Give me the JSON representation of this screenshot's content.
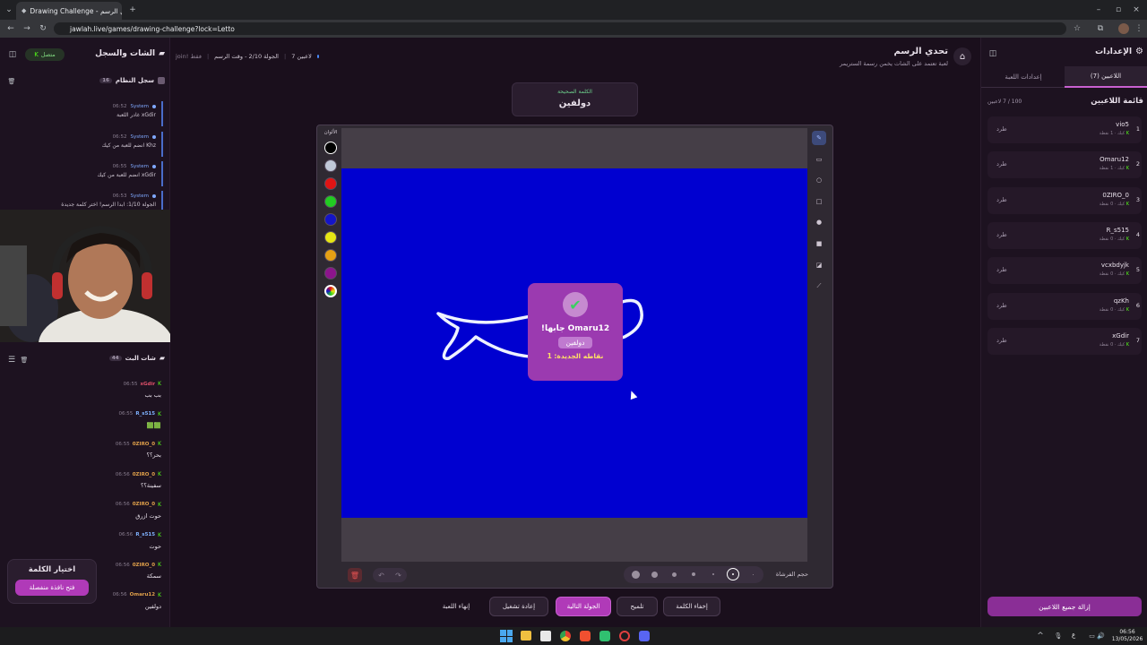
{
  "browser": {
    "tab_title": "Drawing Challenge - تحدي الرسم",
    "url": "jawlah.live/games/drawing-challenge?lock=Letto"
  },
  "left": {
    "title": "الشات والسجل",
    "status": "متصل",
    "system_log_title": "سجل النظام",
    "system_log_count": "16",
    "system_logs": [
      {
        "time": "06:52",
        "sender": "System",
        "text": "xGdir غادر اللعبة"
      },
      {
        "time": "06:52",
        "sender": "System",
        "text": "Khz انضم للعبة من كيك"
      },
      {
        "time": "06:55",
        "sender": "System",
        "text": "xGdir انضم للعبة من كيك"
      },
      {
        "time": "06:53",
        "sender": "System",
        "text": "الجولة 1/10: ابدأ الرسم! اختر كلمة جديدة"
      }
    ],
    "chat_title": "شات البث",
    "chat_count": "44",
    "chat": [
      {
        "time": "06:55",
        "user": "xGdir",
        "text": "بب بب",
        "color": "#e0506a"
      },
      {
        "time": "06:55",
        "user": "R_s515",
        "text": "🟩🟩",
        "color": "#7fb2ff"
      },
      {
        "time": "06:55",
        "user": "0ZIRO_0",
        "text": "بحر؟؟",
        "color": "#e0a04a"
      },
      {
        "time": "06:56",
        "user": "0ZIRO_0",
        "text": "سفينة؟؟",
        "color": "#e0a04a"
      },
      {
        "time": "06:56",
        "user": "0ZIRO_0",
        "text": "حوت ازرق",
        "color": "#e0a04a"
      },
      {
        "time": "06:56",
        "user": "R_s515",
        "text": "حوت",
        "color": "#7fb2ff"
      },
      {
        "time": "06:56",
        "user": "0ZIRO_0",
        "text": "سمكة",
        "color": "#e0a04a"
      },
      {
        "time": "06:56",
        "user": "Omaru12",
        "text": "دولفين",
        "color": "#e0a04a"
      }
    ],
    "word_pick_title": "اختيار الكلمة",
    "word_pick_button": "فتح نافذة منفصلة"
  },
  "header": {
    "title": "تحدي الرسم",
    "subtitle": "لعبة تعتمد على الشات يخمن رسمة الستريمر",
    "players_count": "7 لاعبين",
    "round_info": "الجولة 2/10 - وقت الرسم",
    "mode": "join! فقط"
  },
  "word_box": {
    "label": "الكلمة الصحيحة",
    "word": "دولفين"
  },
  "canvas": {
    "colors_label": "الألوان",
    "colors": [
      "#000000",
      "#c0c8d8",
      "#e01414",
      "#22cc22",
      "#1414c8",
      "#e6e614",
      "#e6a014",
      "#8c148c"
    ],
    "bg_color": "#0000d0",
    "brush_label": "حجم الفرشاة"
  },
  "popup": {
    "title": "Omaru12 جابها!",
    "word": "دولفين",
    "points": "نقاطه الجديدة: 1"
  },
  "actions": {
    "hide_word": "إخفاء الكلمة",
    "hint": "تلميح",
    "next_round": "الجولة التالية",
    "replay": "إعادة تشغيل",
    "end_game": "إنهاء اللعبة"
  },
  "right": {
    "title": "الإعدادات",
    "tab_players": "اللاعبين (7)",
    "tab_settings": "إعدادات اللعبة",
    "list_title": "قائمة اللاعبين",
    "capacity": "100 / 7 لاعبين",
    "kick_label": "طرد",
    "players": [
      {
        "rank": "1",
        "name": "vio5",
        "meta": "كيك · 1 نقطة"
      },
      {
        "rank": "2",
        "name": "Omaru12",
        "meta": "كيك · 1 نقطة"
      },
      {
        "rank": "3",
        "name": "0ZIRO_0",
        "meta": "كيك · 0 نقطة"
      },
      {
        "rank": "4",
        "name": "R_s515",
        "meta": "كيك · 0 نقطة"
      },
      {
        "rank": "5",
        "name": "vcxbdyjk",
        "meta": "كيك · 0 نقطة"
      },
      {
        "rank": "6",
        "name": "qzKh",
        "meta": "كيك · 0 نقطة"
      },
      {
        "rank": "7",
        "name": "xGdir",
        "meta": "كيك · 0 نقطة"
      }
    ],
    "remove_all": "إزالة جميع اللاعبين"
  },
  "taskbar": {
    "time": "06:56",
    "date": "13/05/2026",
    "lang": "ع"
  }
}
